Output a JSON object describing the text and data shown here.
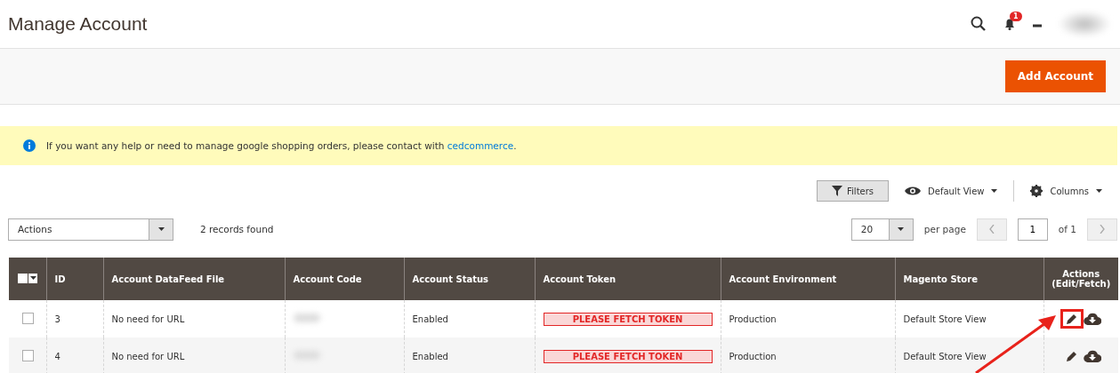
{
  "page_title": "Manage Account",
  "header": {
    "notification_count": "1"
  },
  "add_button": "Add Account",
  "notice": {
    "text": "If you want any help or need to manage google shopping orders, please contact with ",
    "link": "cedcommerce",
    "end": "."
  },
  "toolbar": {
    "filters": "Filters",
    "view": "Default View",
    "columns": "Columns"
  },
  "actions_select": "Actions",
  "records": "2 records found",
  "pager": {
    "per_page_value": "20",
    "per_page_label": "per page",
    "page": "1",
    "of": "of 1"
  },
  "table": {
    "mass_select_checked": false,
    "columns": [
      "ID",
      "Account DataFeed File",
      "Account Code",
      "Account Status",
      "Account Token",
      "Account Environment",
      "Magento Store",
      "Actions (Edit/Fetch)"
    ],
    "rows": [
      {
        "checked": false,
        "id": "3",
        "file": "No need for URL",
        "status": "Enabled",
        "token": "PLEASE FETCH TOKEN",
        "environment": "Production",
        "store": "Default Store View",
        "highlighted": true
      },
      {
        "checked": false,
        "id": "4",
        "file": "No need for URL",
        "status": "Enabled",
        "token": "PLEASE FETCH TOKEN",
        "environment": "Production",
        "store": "Default Store View",
        "highlighted": false
      }
    ]
  }
}
